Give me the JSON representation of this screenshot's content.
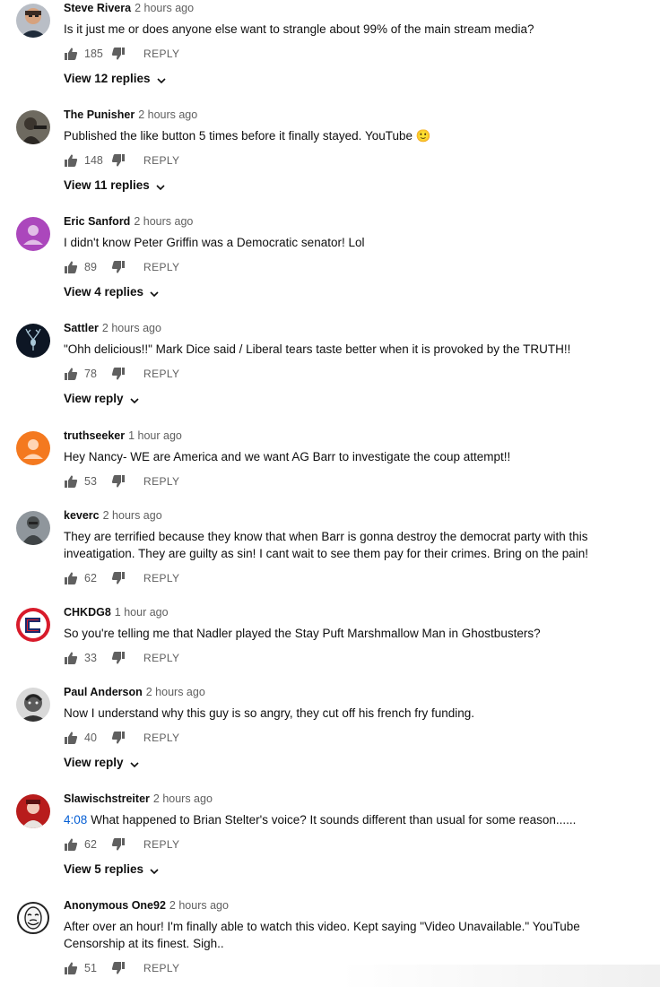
{
  "comments": [
    {
      "author": "Steve Rivera",
      "time": "2 hours ago",
      "text": "Is it just me or does anyone else want to strangle about 99% of the main stream media?",
      "likes": "185",
      "reply_label": "REPLY",
      "view_replies": "View 12 replies",
      "avatar": "photo-man-face"
    },
    {
      "author": "The Punisher",
      "time": "2 hours ago",
      "text": "Published the like button 5 times before it finally stayed. YouTube",
      "emoji": "🙂",
      "likes": "148",
      "reply_label": "REPLY",
      "view_replies": "View 11 replies",
      "avatar": "photo-dark-figure"
    },
    {
      "author": "Eric Sanford",
      "time": "2 hours ago",
      "text": "I didn't know Peter Griffin was a Democratic senator!  Lol",
      "likes": "89",
      "reply_label": "REPLY",
      "view_replies": "View 4 replies",
      "avatar": "default-purple"
    },
    {
      "author": "Sattler",
      "time": "2 hours ago",
      "text": "\"Ohh delicious!!\" Mark Dice said / Liberal tears taste better when it is provoked by the TRUTH!!",
      "likes": "78",
      "reply_label": "REPLY",
      "view_replies": "View reply",
      "avatar": "stag-dark"
    },
    {
      "author": "truthseeker",
      "time": "1 hour ago",
      "text": "Hey Nancy- WE are America and we want AG Barr to investigate the coup attempt!!",
      "likes": "53",
      "reply_label": "REPLY",
      "avatar": "default-orange"
    },
    {
      "author": "keverc",
      "time": "2 hours ago",
      "text": "They are terrified because they know that when Barr is gonna destroy the democrat party with this inveatigation. They are guilty as sin! I cant wait to see them pay for their crimes. Bring on the pain!",
      "likes": "62",
      "reply_label": "REPLY",
      "avatar": "photo-soldier"
    },
    {
      "author": "CHKDG8",
      "time": "1 hour ago",
      "text": "So you're telling me that Nadler played the Stay Puft Marshmallow Man in Ghostbusters?",
      "likes": "33",
      "reply_label": "REPLY",
      "avatar": "logo-red-blue"
    },
    {
      "author": "Paul Anderson",
      "time": "2 hours ago",
      "text": "Now I understand why this guy is so angry, they cut off his french fry funding.",
      "likes": "40",
      "reply_label": "REPLY",
      "view_replies": "View reply",
      "avatar": "photo-bw-face"
    },
    {
      "author": "Slawischstreiter",
      "time": "2 hours ago",
      "timestamp_link": "4:08",
      "text": "What happened to Brian Stelter's voice? It sounds different than usual for some reason......",
      "likes": "62",
      "reply_label": "REPLY",
      "view_replies": "View 5 replies",
      "avatar": "photo-red"
    },
    {
      "author": "Anonymous One92",
      "time": "2 hours ago",
      "text": "After over an hour! I'm finally able to watch this video. Kept saying \"Video Unavailable.\" YouTube Censorship at its finest. Sigh..",
      "likes": "51",
      "reply_label": "REPLY",
      "avatar": "mask-bw"
    }
  ],
  "colors": {
    "author": "#0f0f0f",
    "meta": "#606060",
    "link": "#065fd4"
  }
}
